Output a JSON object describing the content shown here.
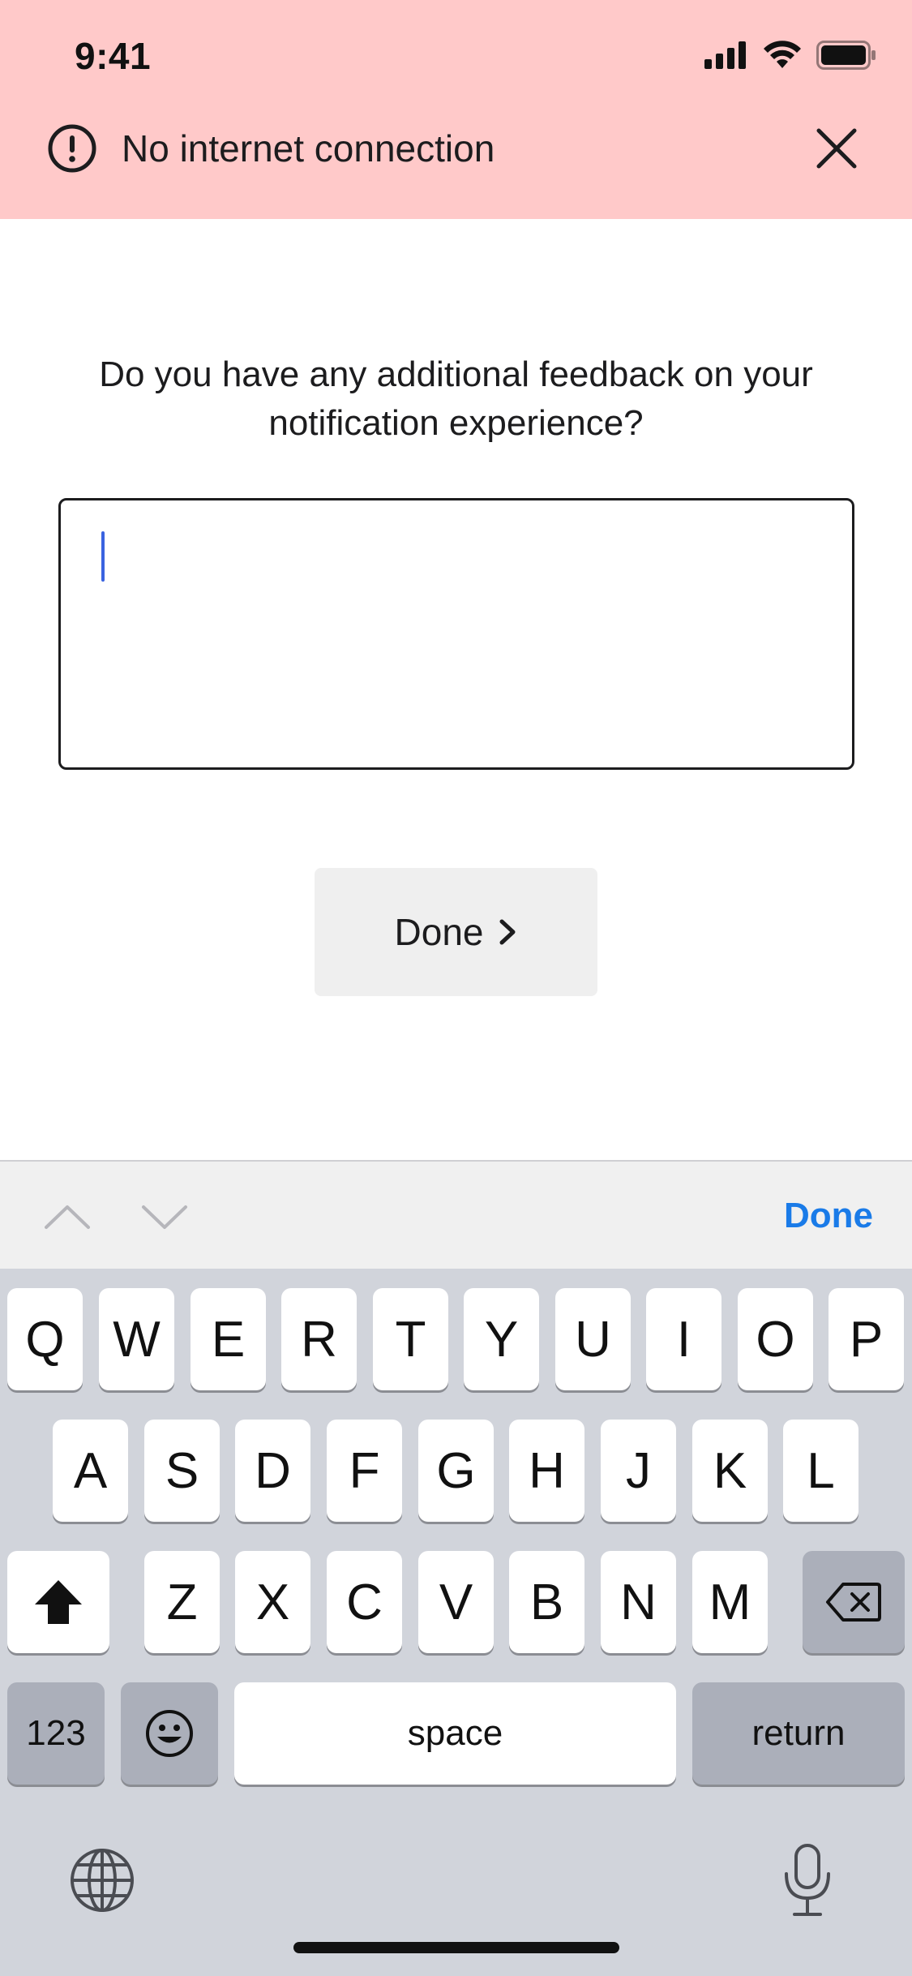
{
  "status_bar": {
    "time": "9:41"
  },
  "banner": {
    "message": "No internet connection",
    "background_color": "#ffc9c9",
    "icons": {
      "alert": "exclamation-circle-icon",
      "close": "close-icon"
    }
  },
  "survey": {
    "question": "Do you have any additional feedback on your notification experience?",
    "input_value": "",
    "done_label": "Done"
  },
  "keyboard_accessory": {
    "done_label": "Done",
    "accent_color": "#1a7be8"
  },
  "keyboard": {
    "row1": [
      "Q",
      "W",
      "E",
      "R",
      "T",
      "Y",
      "U",
      "I",
      "O",
      "P"
    ],
    "row2": [
      "A",
      "S",
      "D",
      "F",
      "G",
      "H",
      "J",
      "K",
      "L"
    ],
    "row3": [
      "Z",
      "X",
      "C",
      "V",
      "B",
      "N",
      "M"
    ],
    "numbers_label": "123",
    "space_label": "space",
    "return_label": "return"
  }
}
